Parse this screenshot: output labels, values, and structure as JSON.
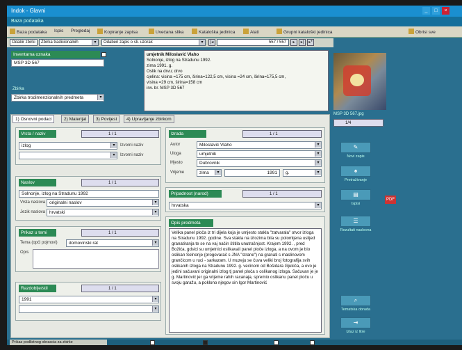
{
  "window": {
    "title": "Indok - Glavni",
    "subtitle": "Baza podataka"
  },
  "toolbar": {
    "items": [
      "Baza podataka",
      "Ispis",
      "Pregledaj",
      "Kopiranje zapisa",
      "Uvećana slika",
      "Kataloška jedinica",
      "Alati",
      "Grupni kataloški jedinica",
      "Obrisi sve"
    ]
  },
  "nav": {
    "filter": "Odabir zbirki",
    "collection": "Zbirka tradicionalnih",
    "search": "Odaberi zapis o sli. uzorak",
    "counter": "557 / 557"
  },
  "left": {
    "inv_label": "Inventarna oznaka",
    "inv_value": "MSP 3D 567",
    "collection_label": "Zbirka",
    "collection_value": "Zbirka trodimenzionalnih predmeta"
  },
  "summary": {
    "lines": [
      "umjetnik Miloslavić Vlaho",
      "Solnonje, izlog na Stradunu 1992.",
      "zima 1991. g.",
      "Oslik na drvu; drvo",
      "cjelina: visina =175 cm, širina=122,5 cm, visina =24 cm, širina=175,5 cm,",
      "visina =29 cm, širina=158 cm",
      "inv. br. MSP 3D 567"
    ]
  },
  "image": {
    "filename": "MSP 3D 567.jpg",
    "pager": "1/4"
  },
  "tabs": [
    "1) Osnovni podaci",
    "2) Materijal",
    "3) Povijest",
    "4) Upravljanje zbirkom"
  ],
  "vrsta": {
    "header": "Vrsta / naziv",
    "pager": "1 / 1",
    "value": "izlog",
    "lbl1": "Izvorni naziv",
    "lbl2": "Izvorni naziv"
  },
  "naslov": {
    "header": "Naslov",
    "pager": "1 / 1",
    "value": "Solnonje, izlog na Stradunu 1992",
    "vrsta_label": "Vrsta naslova",
    "vrsta_value": "originalni naslov",
    "jezik_label": "Jezik naslova",
    "jezik_value": "hrvatski"
  },
  "prikaz": {
    "header": "Prikaz u temi",
    "pager": "1 / 1",
    "type_label": "Tema (opći pojmovi)",
    "type_value": "domovinski rat",
    "opis_label": "Opis"
  },
  "datacija": {
    "header": "Razdoblje/stil",
    "pager": "1 / 1",
    "value": "1991"
  },
  "izrada": {
    "header": "Izrada",
    "pager": "1 / 1",
    "autor_label": "Autor",
    "autor_value": "Miloslavić Vlaho",
    "uloga_label": "Uloga",
    "uloga_value": "umjetnik",
    "mjesto_label": "Mjesto",
    "mjesto_value": "Dubrovnik",
    "vrijeme_label": "Vrijeme",
    "vrijeme_sel": "zima",
    "year": "1991",
    "era": "g."
  },
  "pripadnost": {
    "header": "Pripadnost (narod)",
    "pager": "1 / 1",
    "value": "hrvatska"
  },
  "opis": {
    "header": "Opis predmeta",
    "text": "Velika panel ploča iz tri dijela koja je umjesto stakla \"zatvarala\" otvor izloga na Stradunu 1992. godine. Sva stakla na izlozima bila su polomljena uslijed granatiranja te se na vaj način štitila unutrašnjost. Krajem 1992. , pred Božića, gdsici su umjetnici oslikavali panel ploče izloga, a na ovom je bio oslikan Solnonje (progovarač s JNA \"strane\") na granati s maslinovom grančicom u ruci - sarkazam. U muzeju se čuva veliki broj fotografija svih oslikanih izloga na Stradunu 1992. g. većinom od Bošidara Gjukića, a ovo je jedini sačuvani originalni izlog tj panel ploča s oslikanog izloga. Sačuvan je je g. Martinović jer ga vrijeme rahih racanaja, spremio oslikanu panel ploču u svoju garažu, a poklono njegov sin Igor Martinović"
  },
  "side_buttons": [
    "Novi zapis",
    "Pretraživanje",
    "Ispisi",
    "Rezultati naslovna",
    "Tematska obrada",
    "Izlaz iz litre"
  ],
  "pdf": "PDF",
  "status": {
    "left": "Prikaz podlistnog obrascia za zbirke",
    "items": [
      "",
      "",
      "",
      ""
    ]
  },
  "colors": {
    "accent_green": "#2c8a55",
    "bg": "#2a6f8f",
    "title": "#1a8fd0"
  }
}
